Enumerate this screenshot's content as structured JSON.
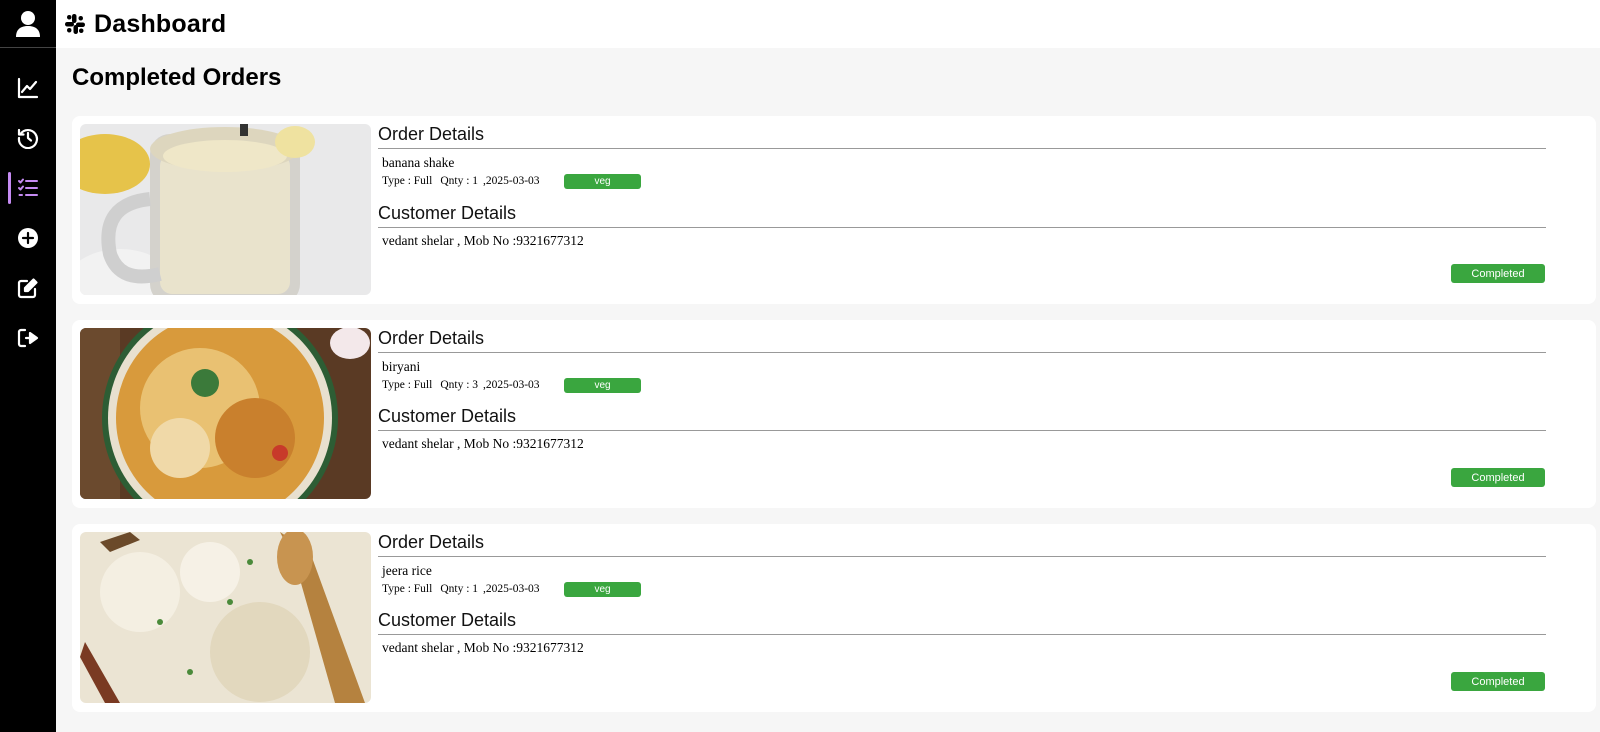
{
  "header": {
    "title": "Dashboard"
  },
  "page": {
    "title": "Completed Orders"
  },
  "sidebar": {
    "items": [
      {
        "icon": "chart-line-icon"
      },
      {
        "icon": "history-icon"
      },
      {
        "icon": "list-check-icon",
        "active": true
      },
      {
        "icon": "plus-circle-icon"
      },
      {
        "icon": "edit-icon"
      },
      {
        "icon": "logout-icon"
      }
    ]
  },
  "orders": [
    {
      "order_heading": "Order Details",
      "item": "banana shake",
      "type": "Type : Full",
      "qty": "Qnty : 1",
      "date": ",2025-03-03",
      "veg": "veg",
      "customer_heading": "Customer Details",
      "customer": "vedant shelar , Mob No :9321677312",
      "status": "Completed"
    },
    {
      "order_heading": "Order Details",
      "item": "biryani",
      "type": "Type : Full",
      "qty": "Qnty : 3",
      "date": ",2025-03-03",
      "veg": "veg",
      "customer_heading": "Customer Details",
      "customer": "vedant shelar , Mob No :9321677312",
      "status": "Completed"
    },
    {
      "order_heading": "Order Details",
      "item": "jeera rice",
      "type": "Type : Full",
      "qty": "Qnty : 1",
      "date": ",2025-03-03",
      "veg": "veg",
      "customer_heading": "Customer Details",
      "customer": "vedant shelar , Mob No :9321677312",
      "status": "Completed"
    }
  ],
  "colors": {
    "accent": "#3aa63f",
    "sidebar": "#000000",
    "active_marker": "#c58bf2"
  }
}
